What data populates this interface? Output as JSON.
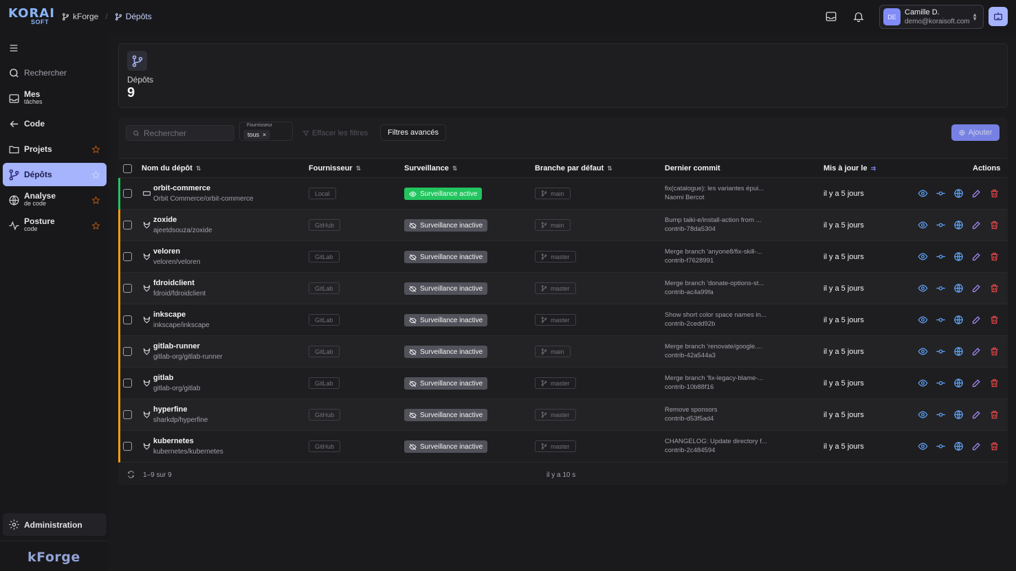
{
  "logo": {
    "top": "KORAI",
    "bottom": "SOFT"
  },
  "breadcrumb": [
    {
      "label": "kForge"
    },
    {
      "label": "Dépôts"
    }
  ],
  "user": {
    "initials": "DE",
    "name": "Camille D.",
    "email": "demo@koraisoft.com"
  },
  "sidebar": {
    "search_label": "Rechercher",
    "items": [
      {
        "label": "Mes",
        "sub": "tâches"
      },
      {
        "label": "Code",
        "sub": ""
      },
      {
        "label": "Projets",
        "sub": ""
      },
      {
        "label": "Dépôts",
        "sub": ""
      },
      {
        "label": "Analyse",
        "sub": "de code"
      },
      {
        "label": "Posture",
        "sub": "code"
      }
    ],
    "admin_label": "Administration",
    "footer_logo": "kForge"
  },
  "stat": {
    "label": "Dépôts",
    "value": "9"
  },
  "toolbar": {
    "search_placeholder": "Rechercher",
    "provider_title": "Fournisseur",
    "provider_value": "tous",
    "clear_label": "Effacer les filtres",
    "advanced_label": "Filtres avancés",
    "add_label": "Ajouter"
  },
  "columns": {
    "name": "Nom du dépôt",
    "provider": "Fournisseur",
    "monitoring": "Surveillance",
    "branch": "Branche par défaut",
    "commit": "Dernier commit",
    "updated": "Mis à jour le",
    "actions": "Actions"
  },
  "rows": [
    {
      "name": "orbit-commerce",
      "path": "Orbit Commerce/orbit-commerce",
      "provider": "Local",
      "monitoring": "Surveillance active",
      "branch": "main",
      "commit_msg": "fix(catalogue): les variantes épui...",
      "commit_by": "Naomi Bercot",
      "updated": "il y a 5 jours"
    },
    {
      "name": "zoxide",
      "path": "ajeetdsouza/zoxide",
      "provider": "GitHub",
      "monitoring": "Surveillance inactive",
      "branch": "main",
      "commit_msg": "Bump taiki-e/install-action from ...",
      "commit_by": "contrib-78da5304",
      "updated": "il y a 5 jours"
    },
    {
      "name": "veloren",
      "path": "veloren/veloren",
      "provider": "GitLab",
      "monitoring": "Surveillance inactive",
      "branch": "master",
      "commit_msg": "Merge branch 'anyone8/fix-skill-...",
      "commit_by": "contrib-f7628991",
      "updated": "il y a 5 jours"
    },
    {
      "name": "fdroidclient",
      "path": "fdroid/fdroidclient",
      "provider": "GitLab",
      "monitoring": "Surveillance inactive",
      "branch": "master",
      "commit_msg": "Merge branch 'donate-options-st...",
      "commit_by": "contrib-ac4a99fa",
      "updated": "il y a 5 jours"
    },
    {
      "name": "inkscape",
      "path": "inkscape/inkscape",
      "provider": "GitLab",
      "monitoring": "Surveillance inactive",
      "branch": "master",
      "commit_msg": "Show short color space names in...",
      "commit_by": "contrib-2cedd92b",
      "updated": "il y a 5 jours"
    },
    {
      "name": "gitlab-runner",
      "path": "gitlab-org/gitlab-runner",
      "provider": "GitLab",
      "monitoring": "Surveillance inactive",
      "branch": "main",
      "commit_msg": "Merge branch 'renovate/google....",
      "commit_by": "contrib-42a544a3",
      "updated": "il y a 5 jours"
    },
    {
      "name": "gitlab",
      "path": "gitlab-org/gitlab",
      "provider": "GitLab",
      "monitoring": "Surveillance inactive",
      "branch": "master",
      "commit_msg": "Merge branch 'fix-legacy-blame-...",
      "commit_by": "contrib-10b88f16",
      "updated": "il y a 5 jours"
    },
    {
      "name": "hyperfine",
      "path": "sharkdp/hyperfine",
      "provider": "GitHub",
      "monitoring": "Surveillance inactive",
      "branch": "master",
      "commit_msg": "Remove sponsors",
      "commit_by": "contrib-d53f5ad4",
      "updated": "il y a 5 jours"
    },
    {
      "name": "kubernetes",
      "path": "kubernetes/kubernetes",
      "provider": "GitHub",
      "monitoring": "Surveillance inactive",
      "branch": "master",
      "commit_msg": "CHANGELOG: Update directory f...",
      "commit_by": "contrib-2c484594",
      "updated": "il y a 5 jours"
    }
  ],
  "footer": {
    "count": "1–9 sur 9",
    "refreshed": "il y a 10 s"
  },
  "colors": {
    "accent": "#a5b4fc",
    "active": "#22c55e",
    "inactive": "#52525b",
    "warn_bar": "#f59e0b",
    "delete": "#ef4444"
  }
}
